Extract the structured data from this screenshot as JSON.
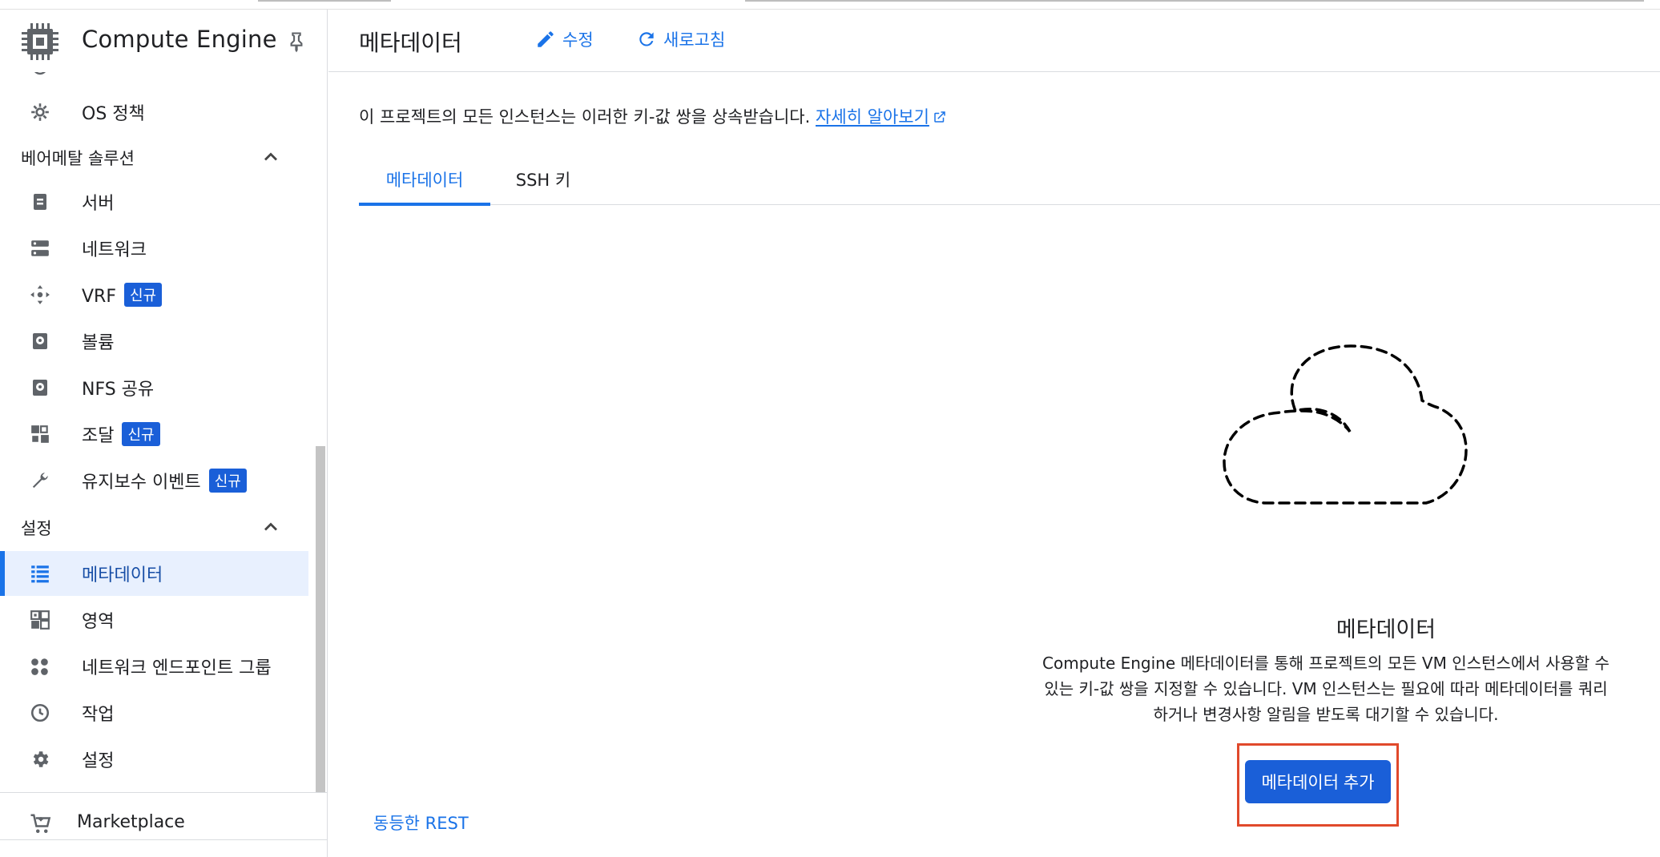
{
  "app": {
    "title": "Compute Engine",
    "accent_color": "#1a73e8",
    "button_color": "#1a5fd8",
    "highlight_color": "#e0492b"
  },
  "sidebar": {
    "items": [
      {
        "label": "OS 정책",
        "icon": "gear-policy-icon"
      },
      {
        "label": "서버",
        "icon": "server-icon"
      },
      {
        "label": "네트워크",
        "icon": "network-icon"
      },
      {
        "label": "VRF",
        "icon": "vrf-icon",
        "badge": "신규"
      },
      {
        "label": "볼륨",
        "icon": "disk-icon"
      },
      {
        "label": "NFS 공유",
        "icon": "nfs-icon"
      },
      {
        "label": "조달",
        "icon": "procurement-icon",
        "badge": "신규"
      },
      {
        "label": "유지보수 이벤트",
        "icon": "wrench-icon",
        "badge": "신규"
      },
      {
        "label": "메타데이터",
        "icon": "metadata-list-icon",
        "active": true
      },
      {
        "label": "영역",
        "icon": "zones-icon"
      },
      {
        "label": "네트워크 엔드포인트 그룹",
        "icon": "endpoint-group-icon"
      },
      {
        "label": "작업",
        "icon": "clock-icon"
      },
      {
        "label": "설정",
        "icon": "settings-icon"
      }
    ],
    "sections": {
      "baremetal": "베어메탈 솔루션",
      "settings": "설정"
    },
    "marketplace": "Marketplace"
  },
  "header": {
    "title": "메타데이터",
    "edit_label": "수정",
    "refresh_label": "새로고침"
  },
  "main": {
    "description": "이 프로젝트의 모든 인스턴스는 이러한 키-값 쌍을 상속받습니다.",
    "learn_more": "자세히 알아보기",
    "tabs": [
      {
        "label": "메타데이터",
        "selected": true
      },
      {
        "label": "SSH 키",
        "selected": false
      }
    ],
    "empty_state": {
      "title": "메타데이터",
      "line1": "Compute Engine 메타데이터를 통해 프로젝트의 모든 VM 인스턴스에서 사용할 수",
      "line2": "있는 키-값 쌍을 지정할 수 있습니다. VM 인스턴스는 필요에 따라 메타데이터를 쿼리",
      "line3": "하거나 변경사항 알림을 받도록 대기할 수 있습니다.",
      "add_button": "메타데이터 추가"
    },
    "rest_link": "동등한 REST"
  }
}
